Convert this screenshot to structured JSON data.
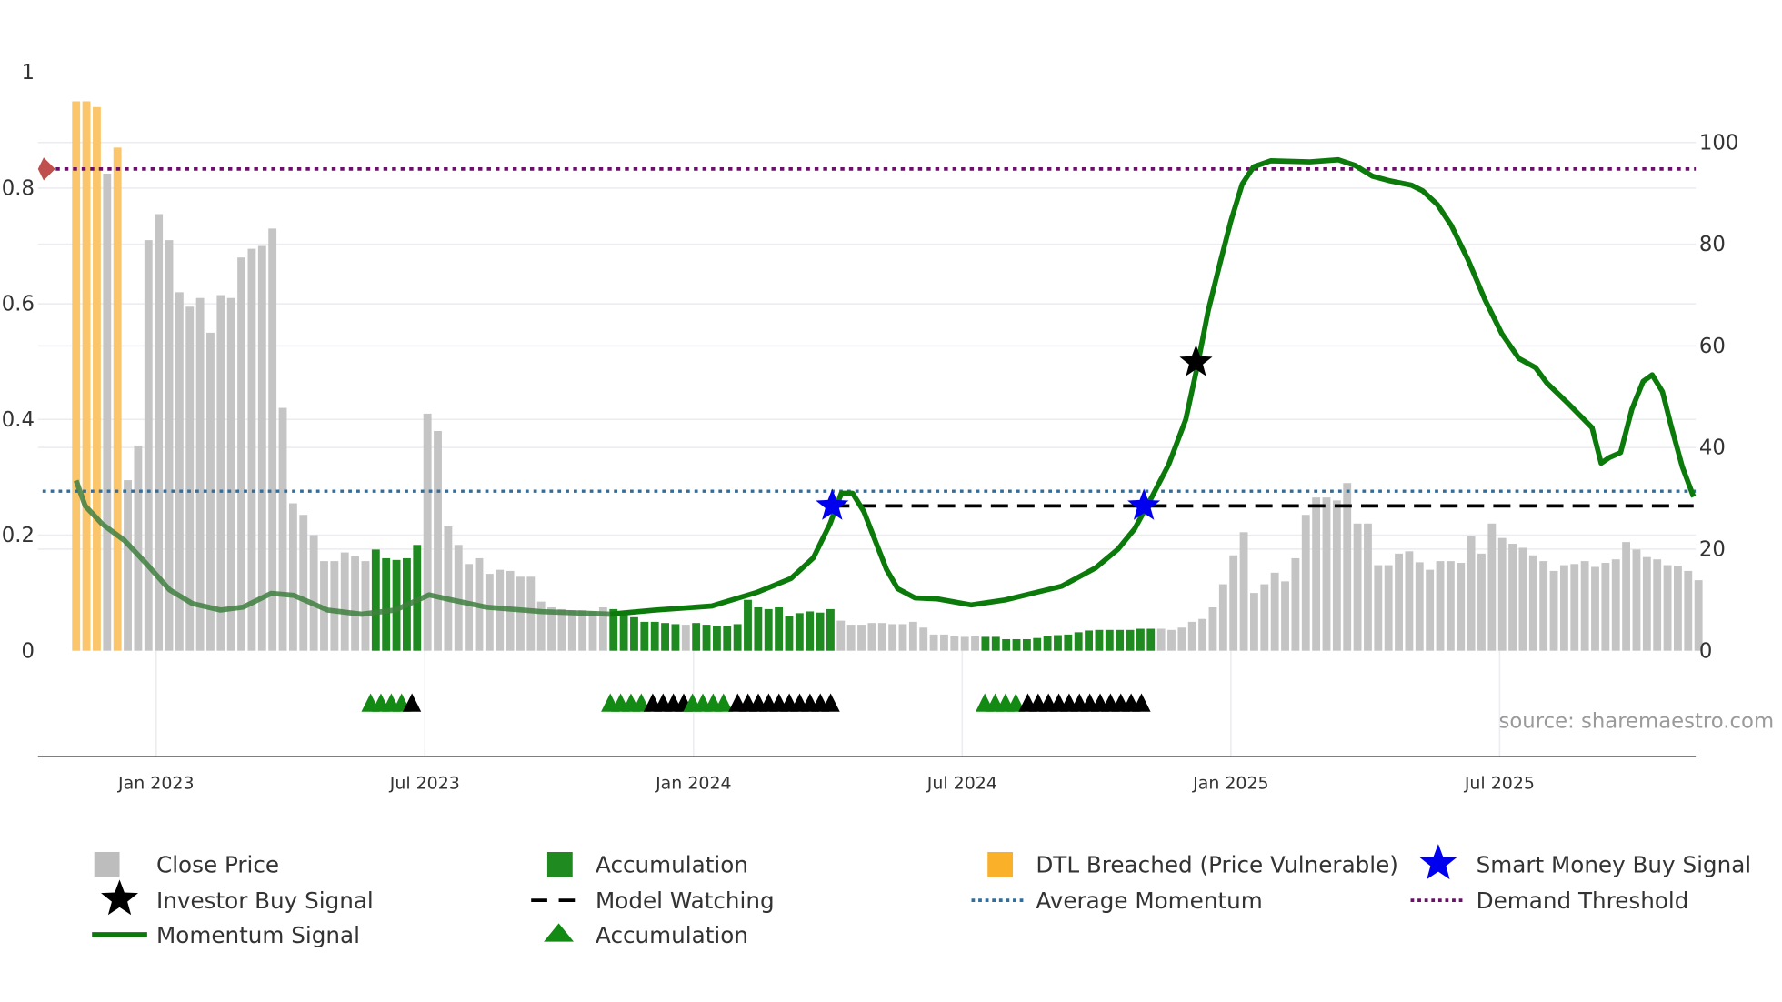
{
  "chart_data": {
    "type": "bar+line",
    "title": "",
    "source": "source: sharemaestro.com",
    "x_ticks": [
      {
        "label": "Jan 2023",
        "x": 2023.0
      },
      {
        "label": "Jul 2023",
        "x": 2023.5
      },
      {
        "label": "Jan 2024",
        "x": 2024.0
      },
      {
        "label": "Jul 2024",
        "x": 2024.5
      },
      {
        "label": "Jan 2025",
        "x": 2025.0
      },
      {
        "label": "Jul 2025",
        "x": 2025.5
      }
    ],
    "xlim": [
      2022.78,
      2025.865
    ],
    "left_axis": {
      "ylim": [
        0,
        1
      ],
      "ticks": [
        "0",
        "0.2",
        "0.4",
        "0.6",
        "0.8",
        "1"
      ],
      "tick_values": [
        0,
        0.2,
        0.4,
        0.6,
        0.8,
        1
      ]
    },
    "right_axis": {
      "ylim": [
        0,
        113.8
      ],
      "ticks": [
        "0",
        "20",
        "40",
        "60",
        "80",
        "100"
      ],
      "tick_values": [
        0,
        20,
        40,
        60,
        80,
        100
      ]
    },
    "bars": {
      "first_x": 2022.851,
      "step": 0.01923,
      "segments": [
        {
          "type": "dtl",
          "values": [
            0.95,
            0.95,
            0.94
          ]
        },
        {
          "type": "close",
          "values": [
            0.825
          ]
        },
        {
          "type": "dtl",
          "values": [
            0.87
          ]
        },
        {
          "type": "close",
          "values": [
            0.295,
            0.355,
            0.71,
            0.755,
            0.71,
            0.62,
            0.595,
            0.61,
            0.55,
            0.615,
            0.61,
            0.68,
            0.695,
            0.7,
            0.73,
            0.42,
            0.255,
            0.235,
            0.2,
            0.155,
            0.155,
            0.17,
            0.163,
            0.155
          ]
        },
        {
          "type": "accum",
          "values": [
            0.175,
            0.16,
            0.157,
            0.16,
            0.183
          ]
        },
        {
          "type": "close",
          "values": [
            0.41,
            0.38,
            0.215,
            0.183,
            0.15,
            0.16,
            0.133,
            0.14,
            0.138,
            0.128,
            0.128,
            0.085,
            0.075,
            0.072,
            0.07,
            0.07,
            0.068,
            0.075
          ]
        },
        {
          "type": "accum",
          "values": [
            0.072,
            0.062,
            0.058,
            0.05,
            0.05,
            0.048,
            0.046
          ]
        },
        {
          "type": "close",
          "values": [
            0.045
          ]
        },
        {
          "type": "accum",
          "values": [
            0.048,
            0.045,
            0.043,
            0.043,
            0.046,
            0.088,
            0.075,
            0.072,
            0.075,
            0.06,
            0.065,
            0.068,
            0.066,
            0.072
          ]
        },
        {
          "type": "close",
          "values": [
            0.052,
            0.045,
            0.045,
            0.048,
            0.048,
            0.046,
            0.046,
            0.05,
            0.04,
            0.028,
            0.028,
            0.025,
            0.024,
            0.025
          ]
        },
        {
          "type": "accum",
          "values": [
            0.024,
            0.024,
            0.02,
            0.02,
            0.02,
            0.022,
            0.025,
            0.027,
            0.028,
            0.032,
            0.035,
            0.036,
            0.036,
            0.036,
            0.036,
            0.038,
            0.038
          ]
        },
        {
          "type": "close",
          "values": [
            0.038,
            0.036,
            0.04,
            0.05,
            0.055,
            0.075,
            0.115,
            0.165,
            0.205,
            0.1,
            0.115,
            0.135,
            0.12,
            0.16,
            0.235,
            0.265,
            0.265,
            0.26,
            0.29,
            0.22,
            0.22,
            0.148,
            0.148,
            0.168,
            0.172,
            0.153,
            0.14,
            0.155,
            0.155,
            0.152,
            0.198,
            0.168,
            0.22,
            0.195,
            0.185,
            0.178,
            0.165,
            0.155,
            0.138,
            0.148,
            0.15,
            0.155,
            0.145,
            0.152,
            0.158,
            0.188,
            0.175,
            0.162,
            0.158,
            0.148,
            0.147,
            0.138,
            0.122
          ]
        }
      ]
    },
    "momentum": {
      "faded_until": 2023.845,
      "x": [
        2022.851,
        2022.868,
        2022.899,
        2022.941,
        2022.983,
        2023.025,
        2023.067,
        2023.12,
        2023.162,
        2023.214,
        2023.256,
        2023.319,
        2023.382,
        2023.445,
        2023.508,
        2023.55,
        2023.613,
        2023.718,
        2023.845,
        2023.929,
        2024.034,
        2024.118,
        2024.181,
        2024.223,
        2024.254,
        2024.275,
        2024.296,
        2024.317,
        2024.338,
        2024.359,
        2024.38,
        2024.412,
        2024.454,
        2024.517,
        2024.58,
        2024.685,
        2024.748,
        2024.79,
        2024.821,
        2024.853,
        2024.884,
        2024.916,
        2024.937,
        2024.958,
        2024.979,
        2025.0,
        2025.021,
        2025.042,
        2025.074,
        2025.147,
        2025.2,
        2025.231,
        2025.263,
        2025.294,
        2025.336,
        2025.357,
        2025.384,
        2025.41,
        2025.441,
        2025.473,
        2025.504,
        2025.536,
        2025.567,
        2025.588,
        2025.63,
        2025.672,
        2025.689,
        2025.704,
        2025.725,
        2025.746,
        2025.767,
        2025.784,
        2025.803,
        2025.819,
        2025.84,
        2025.861
      ],
      "y": [
        33.5,
        28.5,
        25,
        21.7,
        17,
        12,
        9.3,
        8,
        8.6,
        11.3,
        10.9,
        8,
        7.2,
        8,
        11,
        10,
        8.6,
        7.7,
        7.2,
        8,
        8.8,
        11.5,
        14.2,
        18.3,
        25,
        31,
        31,
        27.4,
        21.7,
        16,
        12.2,
        10.4,
        10.2,
        9,
        10,
        12.7,
        16.3,
        20,
        24,
        30.3,
        36.6,
        45.5,
        55.7,
        67,
        76,
        84.6,
        91.8,
        95.2,
        96.4,
        96.2,
        96.6,
        95.5,
        93.4,
        92.5,
        91.6,
        90.5,
        87.8,
        83.7,
        77,
        69,
        62.4,
        57.5,
        55.7,
        52.7,
        48.4,
        43.9,
        36.9,
        38,
        39,
        47.5,
        53,
        54.3,
        51,
        44.3,
        36.2,
        30.3
      ]
    },
    "average_momentum": 31.4,
    "demand_threshold": 94.8,
    "model_watching": {
      "from": 2024.258,
      "to": 2025.861,
      "y": 28.5
    },
    "smart_money_signals": [
      {
        "x": 2024.258,
        "y": 28.5
      },
      {
        "x": 2024.838,
        "y": 28.5
      }
    ],
    "investor_buy_signals": [
      {
        "x": 2024.935,
        "y": 56.8
      }
    ],
    "accumulation_markers": [
      {
        "start": 2023.399,
        "count": 4,
        "kind": "accumulation"
      },
      {
        "start": 2023.476,
        "count": 1,
        "kind": "watching"
      },
      {
        "start": 2023.845,
        "count": 4,
        "kind": "accumulation"
      },
      {
        "start": 2023.924,
        "count": 4,
        "kind": "watching"
      },
      {
        "start": 2023.998,
        "count": 4,
        "kind": "accumulation"
      },
      {
        "start": 2024.082,
        "count": 10,
        "kind": "watching"
      },
      {
        "start": 2024.542,
        "count": 4,
        "kind": "accumulation"
      },
      {
        "start": 2024.622,
        "count": 12,
        "kind": "watching"
      }
    ],
    "legend": [
      {
        "label": "Close Price",
        "symbol": "close-bar"
      },
      {
        "label": "Accumulation",
        "symbol": "accum-bar"
      },
      {
        "label": "DTL Breached (Price Vulnerable)",
        "symbol": "dtl-bar"
      },
      {
        "label": "Smart Money Buy Signal",
        "symbol": "blue-star"
      },
      {
        "label": "Investor Buy Signal",
        "symbol": "black-star"
      },
      {
        "label": "Model Watching",
        "symbol": "dash-line"
      },
      {
        "label": "Average Momentum",
        "symbol": "blue-dot-line"
      },
      {
        "label": "Demand Threshold",
        "symbol": "purple-dot-line"
      },
      {
        "label": "Momentum Signal",
        "symbol": "green-line"
      },
      {
        "label": "Accumulation",
        "symbol": "green-triangle"
      }
    ],
    "colors": {
      "close": "#c4c4c4",
      "accum": "#1f8a1f",
      "dtl": "#fbc66b",
      "momentum": "#0b7a0b",
      "avg": "#2f6e9e",
      "threshold": "#6b0f6b",
      "smart": "#0000ee",
      "investor": "#000000",
      "grid": "#ebebf0"
    }
  }
}
